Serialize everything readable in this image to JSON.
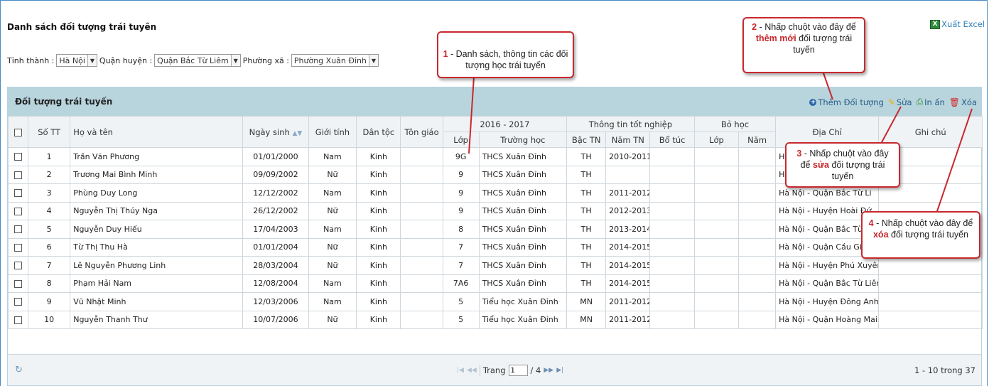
{
  "page": {
    "title": "Danh sách đối tượng trái tuyên",
    "export_label": "Xuất Excel",
    "excel_icon_text": "X"
  },
  "filters": {
    "province_label": "Tỉnh thành :",
    "province_value": "Hà Nội",
    "district_label": "Quận huyện :",
    "district_value": "Quận Bắc Từ Liêm",
    "ward_label": "Phường xã :",
    "ward_value": "Phường Xuân Đỉnh"
  },
  "panel": {
    "title": "Đối tượng trái tuyến",
    "toolbar": {
      "add_label": "Thêm Đối tượng",
      "edit_label": "Sửa",
      "print_label": "In ấn",
      "delete_label": "Xóa"
    }
  },
  "table": {
    "headers": {
      "stt": "Số TT",
      "name": "Họ và tên",
      "dob": "Ngày sinh",
      "gender": "Giới tính",
      "ethnic": "Dân tộc",
      "religion": "Tôn giáo",
      "school_year": "2016 - 2017",
      "class": "Lớp",
      "school": "Trường học",
      "grad_group": "Thông tin tốt nghiệp",
      "grad_level": "Bậc TN",
      "grad_year": "Năm TN",
      "supplement": "Bổ túc",
      "dropout_group": "Bỏ học",
      "dropout_class": "Lớp",
      "dropout_year": "Năm",
      "address": "Địa Chỉ",
      "note": "Ghi chú"
    },
    "rows": [
      {
        "stt": "1",
        "name": "Trần Văn Phương",
        "dob": "01/01/2000",
        "gender": "Nam",
        "ethnic": "Kinh",
        "religion": "",
        "class": "9G",
        "school": "THCS Xuân Đỉnh",
        "grad_level": "TH",
        "grad_year": "2010-2011",
        "supplement": "",
        "drop_class": "",
        "drop_year": "",
        "address": "Hà",
        "note": ""
      },
      {
        "stt": "2",
        "name": "Trương Mai Bình Minh",
        "dob": "09/09/2002",
        "gender": "Nữ",
        "ethnic": "Kinh",
        "religion": "",
        "class": "9",
        "school": "THCS Xuân Đỉnh",
        "grad_level": "TH",
        "grad_year": "",
        "supplement": "",
        "drop_class": "",
        "drop_year": "",
        "address": "H",
        "note": ""
      },
      {
        "stt": "3",
        "name": "Phùng Duy Long",
        "dob": "12/12/2002",
        "gender": "Nam",
        "ethnic": "Kinh",
        "religion": "",
        "class": "9",
        "school": "THCS Xuân Đỉnh",
        "grad_level": "TH",
        "grad_year": "2011-2012",
        "supplement": "",
        "drop_class": "",
        "drop_year": "",
        "address": "Hà Nội - Quận Bắc Từ Li",
        "note": ""
      },
      {
        "stt": "4",
        "name": "Nguyễn Thị Thúy Nga",
        "dob": "26/12/2002",
        "gender": "Nữ",
        "ethnic": "Kinh",
        "religion": "",
        "class": "9",
        "school": "THCS Xuân Đỉnh",
        "grad_level": "TH",
        "grad_year": "2012-2013",
        "supplement": "",
        "drop_class": "",
        "drop_year": "",
        "address": "Hà Nội - Huyện Hoài Đứ",
        "note": ""
      },
      {
        "stt": "5",
        "name": "Nguyễn Duy Hiếu",
        "dob": "17/04/2003",
        "gender": "Nam",
        "ethnic": "Kinh",
        "religion": "",
        "class": "8",
        "school": "THCS Xuân Đỉnh",
        "grad_level": "TH",
        "grad_year": "2013-2014",
        "supplement": "",
        "drop_class": "",
        "drop_year": "",
        "address": "Hà Nội - Quận Bắc Từ L",
        "note": ""
      },
      {
        "stt": "6",
        "name": "Từ Thị Thu Hà",
        "dob": "01/01/2004",
        "gender": "Nữ",
        "ethnic": "Kinh",
        "religion": "",
        "class": "7",
        "school": "THCS Xuân Đỉnh",
        "grad_level": "TH",
        "grad_year": "2014-2015",
        "supplement": "",
        "drop_class": "",
        "drop_year": "",
        "address": "Hà Nội - Quận Cầu Giấy - Phu",
        "note": ""
      },
      {
        "stt": "7",
        "name": "Lê Nguyễn Phương Linh",
        "dob": "28/03/2004",
        "gender": "Nữ",
        "ethnic": "Kinh",
        "religion": "",
        "class": "7",
        "school": "THCS Xuân Đỉnh",
        "grad_level": "TH",
        "grad_year": "2014-2015",
        "supplement": "",
        "drop_class": "",
        "drop_year": "",
        "address": "Hà Nội - Huyện Phú Xuyên - T",
        "note": ""
      },
      {
        "stt": "8",
        "name": "Phạm Hải Nam",
        "dob": "12/08/2004",
        "gender": "Nam",
        "ethnic": "Kinh",
        "religion": "",
        "class": "7A6",
        "school": "THCS Xuân Đỉnh",
        "grad_level": "TH",
        "grad_year": "2014-2015",
        "supplement": "",
        "drop_class": "",
        "drop_year": "",
        "address": "Hà Nội - Quận Bắc Từ Liêm - F",
        "note": ""
      },
      {
        "stt": "9",
        "name": "Vũ Nhật Minh",
        "dob": "12/03/2006",
        "gender": "Nam",
        "ethnic": "Kinh",
        "religion": "",
        "class": "5",
        "school": "Tiểu học Xuân Đỉnh",
        "grad_level": "MN",
        "grad_year": "2011-2012",
        "supplement": "",
        "drop_class": "",
        "drop_year": "",
        "address": "Hà Nội - Huyện Đông Anh - H",
        "note": ""
      },
      {
        "stt": "10",
        "name": "Nguyễn Thanh Thư",
        "dob": "10/07/2006",
        "gender": "Nữ",
        "ethnic": "Kinh",
        "religion": "",
        "class": "5",
        "school": "Tiểu học Xuân Đỉnh",
        "grad_level": "MN",
        "grad_year": "2011-2012",
        "supplement": "",
        "drop_class": "",
        "drop_year": "",
        "address": "Hà Nội - Quận Hoàng Mai - Tr",
        "note": ""
      }
    ]
  },
  "pager": {
    "page_label": "Trang",
    "page_value": "1",
    "total_pages": "/ 4",
    "range": "1 - 10 trong 37"
  },
  "callouts": {
    "c1": {
      "num": "1",
      "text": " - Danh sách, thông tin các đối tượng học trái tuyến"
    },
    "c2": {
      "num": "2",
      "pre": " - Nhấp chuột vào đây để ",
      "hl": "thêm mới",
      "post": " đối tượng trái tuyến"
    },
    "c3": {
      "num": "3",
      "pre": " - Nhấp chuột vào đây để ",
      "hl": "sửa",
      "post": " đối tượng trái tuyến"
    },
    "c4": {
      "num": "4",
      "pre": " - Nhấp chuột vào đây để ",
      "hl": "xóa",
      "post": " đối tượng trái tuyến"
    }
  },
  "colors": {
    "panel_header_bg": "#b8d5de",
    "callout_border": "#c8282d",
    "link": "#2a5c85"
  }
}
